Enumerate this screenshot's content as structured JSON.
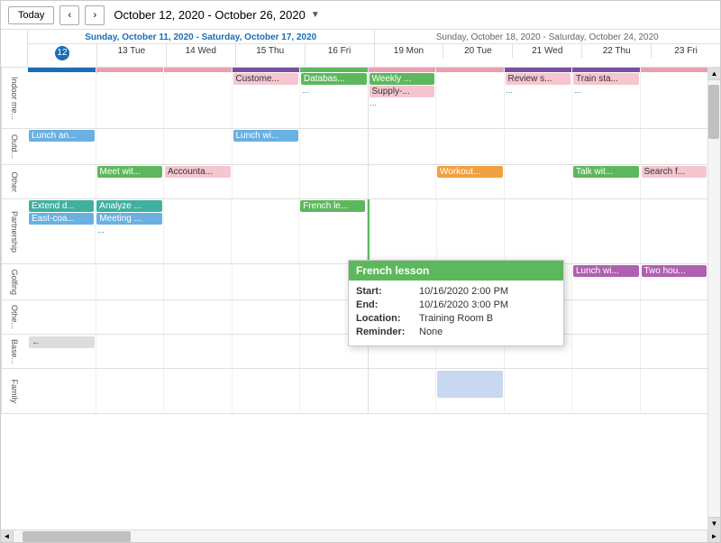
{
  "header": {
    "today_label": "Today",
    "date_range": "October 12, 2020 - October 26, 2020",
    "prev_label": "‹",
    "next_label": "›"
  },
  "weeks": [
    {
      "title": "Sunday, October 11, 2020 - Saturday, October 17, 2020",
      "title_style": "primary",
      "days": [
        {
          "label": "12 Mon",
          "today": true
        },
        {
          "label": "13 Tue",
          "today": false
        },
        {
          "label": "14 Wed",
          "today": false
        },
        {
          "label": "15 Thu",
          "today": false
        },
        {
          "label": "16 Fri",
          "today": false
        }
      ]
    },
    {
      "title": "Sunday, October 18, 2020 - Saturday, October 24, 2020",
      "title_style": "secondary",
      "days": [
        {
          "label": "19 Mon",
          "today": false
        },
        {
          "label": "20 Tue",
          "today": false
        },
        {
          "label": "21 Wed",
          "today": false
        },
        {
          "label": "22 Thu",
          "today": false
        },
        {
          "label": "23 Fri",
          "today": false
        }
      ]
    }
  ],
  "row_labels": [
    "Indoor me...",
    "Outd...",
    "Other",
    "Partnership",
    "Golfing",
    "Othe...",
    "Base...",
    "Family"
  ],
  "tooltip": {
    "title": "French lesson",
    "start_label": "Start:",
    "start_value": "10/16/2020  2:00 PM",
    "end_label": "End:",
    "end_value": "10/16/2020  3:00 PM",
    "location_label": "Location:",
    "location_value": "Training Room B",
    "reminder_label": "Reminder:",
    "reminder_value": "None"
  }
}
